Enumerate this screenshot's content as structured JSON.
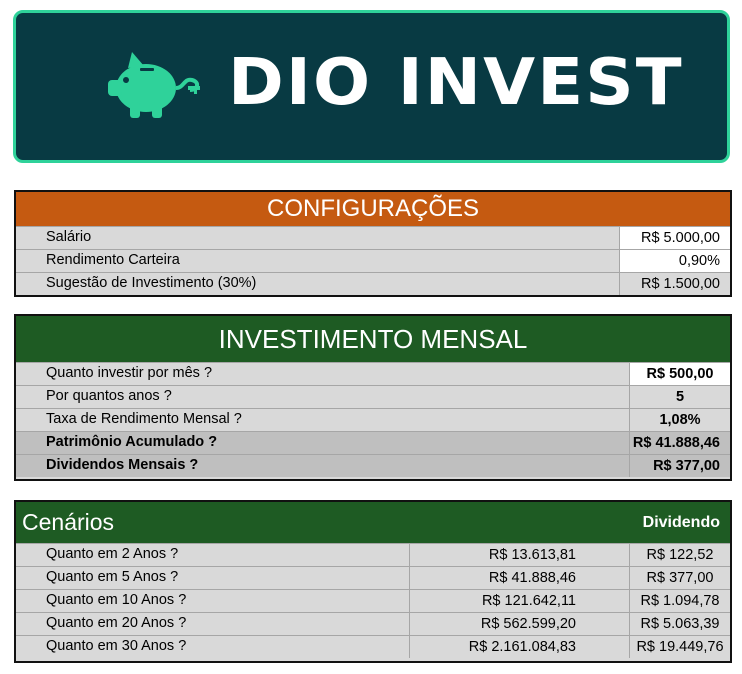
{
  "brand": {
    "name": "DIO INVEST",
    "pig_color": "#2fd29a"
  },
  "config": {
    "title": "CONFIGURAÇÕES",
    "rows": [
      {
        "label": "Salário",
        "value": "R$ 5.000,00"
      },
      {
        "label": "Rendimento Carteira",
        "value": "0,90%"
      },
      {
        "label": "Sugestão de Investimento (30%)",
        "value": "R$ 1.500,00"
      }
    ]
  },
  "invest": {
    "title": "INVESTIMENTO MENSAL",
    "rows": [
      {
        "label": "Quanto investir por mês ?",
        "value": "R$ 500,00"
      },
      {
        "label": "Por quantos anos ?",
        "value": "5"
      },
      {
        "label": "Taxa de Rendimento Mensal ?",
        "value": "1,08%"
      },
      {
        "label": "Patrimônio Acumulado ?",
        "value": "R$ 41.888,46"
      },
      {
        "label": "Dividendos Mensais ?",
        "value": "R$ 377,00"
      }
    ]
  },
  "cenarios": {
    "title": "Cenários",
    "dividend_header": "Dividendo",
    "rows": [
      {
        "label": "Quanto em 2 Anos ?",
        "total": "R$ 13.613,81",
        "dividend": "R$ 122,52"
      },
      {
        "label": "Quanto em 5 Anos ?",
        "total": "R$ 41.888,46",
        "dividend": "R$ 377,00"
      },
      {
        "label": "Quanto em 10 Anos ?",
        "total": "R$ 121.642,11",
        "dividend": "R$ 1.094,78"
      },
      {
        "label": "Quanto em 20 Anos ?",
        "total": "R$ 562.599,20",
        "dividend": "R$ 5.063,39"
      },
      {
        "label": "Quanto em 30 Anos ?",
        "total": "R$ 2.161.084,83",
        "dividend": "R$ 19.449,76"
      }
    ]
  }
}
